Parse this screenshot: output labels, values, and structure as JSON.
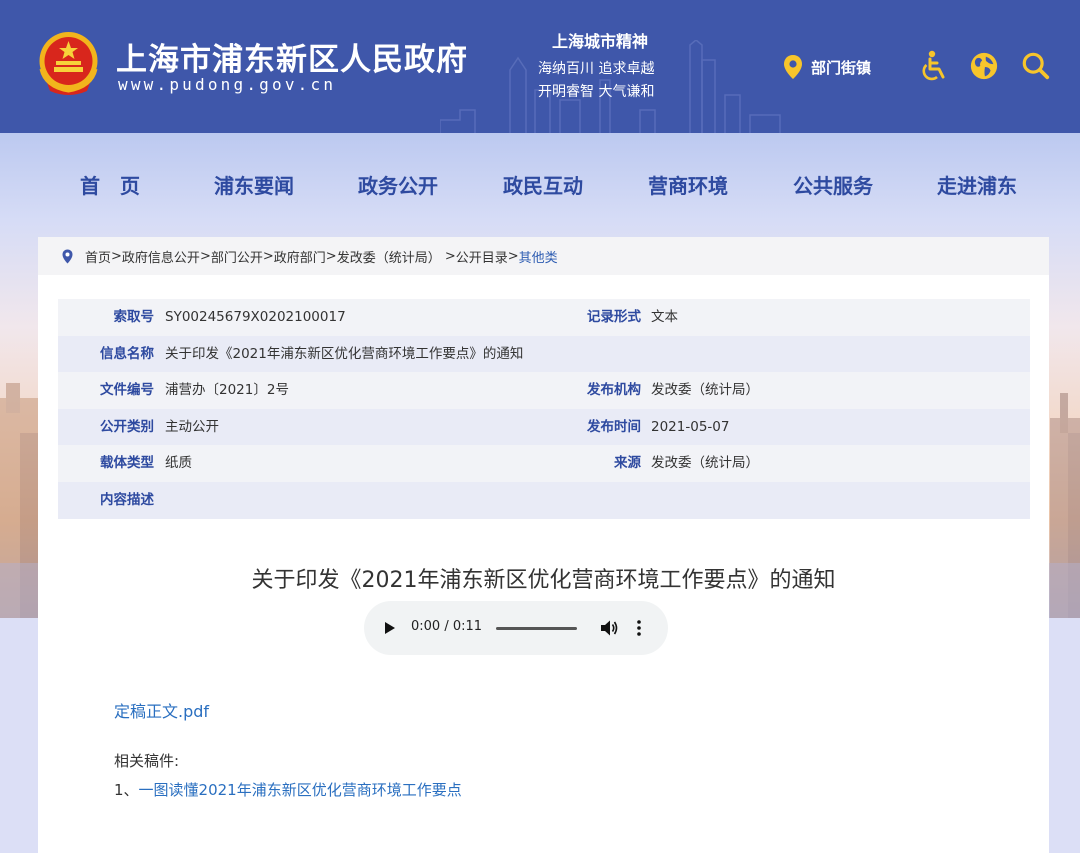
{
  "header": {
    "site_title": "上海市浦东新区人民政府",
    "site_url": "www.pudong.gov.cn",
    "spirit_title": "上海城市精神",
    "spirit_line1": "海纳百川  追求卓越",
    "spirit_line2": "开明睿智  大气谦和",
    "dept_link": "部门街镇",
    "icons": [
      "location-pin-icon",
      "accessibility-icon",
      "globe-icon",
      "search-icon"
    ],
    "brand_color": "#3f57aa",
    "accent_yellow": "#f7c52b"
  },
  "nav": {
    "items": [
      "首　页",
      "浦东要闻",
      "政务公开",
      "政民互动",
      "营商环境",
      "公共服务",
      "走进浦东"
    ]
  },
  "breadcrumb": {
    "items": [
      "首页",
      "政府信息公开",
      "部门公开",
      "政府部门 ",
      " 发改委（统计局）",
      "公开目录"
    ],
    "current": "其他类"
  },
  "meta": {
    "index_no_label": "索取号",
    "index_no": "SY00245679X0202100017",
    "record_form_label": "记录形式",
    "record_form": "文本",
    "info_name_label": "信息名称",
    "info_name": "关于印发《2021年浦东新区优化营商环境工作要点》的通知",
    "doc_no_label": "文件编号",
    "doc_no": "浦营办〔2021〕2号",
    "issuer_label": "发布机构",
    "issuer": "发改委（统计局）",
    "category_label": "公开类别",
    "category": "主动公开",
    "publish_time_label": "发布时间",
    "publish_time": "2021-05-07",
    "carrier_label": "载体类型",
    "carrier": "纸质",
    "source_label": "来源",
    "source": "发改委（统计局）",
    "description_label": "内容描述",
    "description": ""
  },
  "document": {
    "title": "关于印发《2021年浦东新区优化营商环境工作要点》的通知",
    "audio_time": "0:00 / 0:11",
    "audio_progress": 0,
    "pdf_link": "定稿正文.pdf",
    "related_label": "相关稿件:",
    "related_prefix": "1、",
    "related_link": "一图读懂2021年浦东新区优化营商环境工作要点"
  }
}
